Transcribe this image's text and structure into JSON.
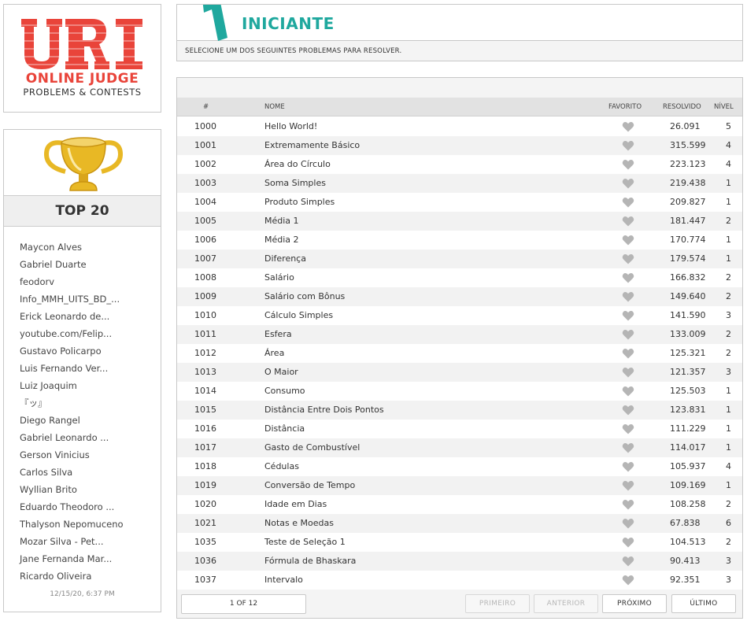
{
  "logo": {
    "mark": "URI",
    "line1": "ONLINE JUDGE",
    "line2": "PROBLEMS & CONTESTS"
  },
  "top20": {
    "title": "TOP 20",
    "users": [
      "Maycon Alves",
      "Gabriel Duarte",
      "feodorv",
      "Info_MMH_UITS_BD_...",
      "Erick Leonardo de...",
      "youtube.com/Felip...",
      "Gustavo Policarpo",
      "Luis Fernando Ver...",
      "Luiz Joaquim",
      "『ッ』",
      "Diego Rangel",
      "Gabriel Leonardo ...",
      "Gerson Vinicius",
      "Carlos Silva",
      "Wyllian Brito",
      "Eduardo Theodoro ...",
      "Thalyson Nepomuceno",
      "Mozar Silva - Pet...",
      "Jane Fernanda Mar...",
      "Ricardo Oliveira"
    ],
    "date": "12/15/20, 6:37 PM"
  },
  "header": {
    "level_number": "1",
    "title": "INICIANTE",
    "subtitle": "SELECIONE UM DOS SEGUINTES PROBLEMAS PARA RESOLVER."
  },
  "table": {
    "columns": {
      "num": "#",
      "name": "NOME",
      "fav": "FAVORITO",
      "solved": "RESOLVIDO",
      "level": "NÍVEL"
    },
    "rows": [
      {
        "num": "1000",
        "name": "Hello World!",
        "solved": "26.091",
        "level": "5"
      },
      {
        "num": "1001",
        "name": "Extremamente Básico",
        "solved": "315.599",
        "level": "4"
      },
      {
        "num": "1002",
        "name": "Área do Círculo",
        "solved": "223.123",
        "level": "4"
      },
      {
        "num": "1003",
        "name": "Soma Simples",
        "solved": "219.438",
        "level": "1"
      },
      {
        "num": "1004",
        "name": "Produto Simples",
        "solved": "209.827",
        "level": "1"
      },
      {
        "num": "1005",
        "name": "Média 1",
        "solved": "181.447",
        "level": "2"
      },
      {
        "num": "1006",
        "name": "Média 2",
        "solved": "170.774",
        "level": "1"
      },
      {
        "num": "1007",
        "name": "Diferença",
        "solved": "179.574",
        "level": "1"
      },
      {
        "num": "1008",
        "name": "Salário",
        "solved": "166.832",
        "level": "2"
      },
      {
        "num": "1009",
        "name": "Salário com Bônus",
        "solved": "149.640",
        "level": "2"
      },
      {
        "num": "1010",
        "name": "Cálculo Simples",
        "solved": "141.590",
        "level": "3"
      },
      {
        "num": "1011",
        "name": "Esfera",
        "solved": "133.009",
        "level": "2"
      },
      {
        "num": "1012",
        "name": "Área",
        "solved": "125.321",
        "level": "2"
      },
      {
        "num": "1013",
        "name": "O Maior",
        "solved": "121.357",
        "level": "3"
      },
      {
        "num": "1014",
        "name": "Consumo",
        "solved": "125.503",
        "level": "1"
      },
      {
        "num": "1015",
        "name": "Distância Entre Dois Pontos",
        "solved": "123.831",
        "level": "1"
      },
      {
        "num": "1016",
        "name": "Distância",
        "solved": "111.229",
        "level": "1"
      },
      {
        "num": "1017",
        "name": "Gasto de Combustível",
        "solved": "114.017",
        "level": "1"
      },
      {
        "num": "1018",
        "name": "Cédulas",
        "solved": "105.937",
        "level": "4"
      },
      {
        "num": "1019",
        "name": "Conversão de Tempo",
        "solved": "109.169",
        "level": "1"
      },
      {
        "num": "1020",
        "name": "Idade em Dias",
        "solved": "108.258",
        "level": "2"
      },
      {
        "num": "1021",
        "name": "Notas e Moedas",
        "solved": "67.838",
        "level": "6"
      },
      {
        "num": "1035",
        "name": "Teste de Seleção 1",
        "solved": "104.513",
        "level": "2"
      },
      {
        "num": "1036",
        "name": "Fórmula de Bhaskara",
        "solved": "90.413",
        "level": "3"
      },
      {
        "num": "1037",
        "name": "Intervalo",
        "solved": "92.351",
        "level": "3"
      }
    ]
  },
  "pagination": {
    "indicator": "1 OF 12",
    "first": "PRIMEIRO",
    "prev": "ANTERIOR",
    "next": "PRÓXIMO",
    "last": "ÚLTIMO"
  },
  "colors": {
    "brand_red": "#e9443a",
    "accent_teal": "#1fa89e",
    "heart_gray": "#b5b5b5",
    "trophy_gold": "#e8b825"
  }
}
